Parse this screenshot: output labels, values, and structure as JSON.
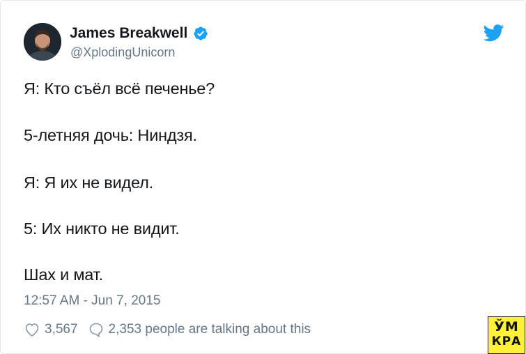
{
  "author": {
    "name": "James Breakwell",
    "handle": "@XplodingUnicorn",
    "verified_icon": "verified-badge-icon",
    "brand_color": "#1da1f2"
  },
  "tweet": {
    "lines": [
      "Я: Кто съёл всё печенье?",
      "5-летняя дочь: Ниндзя.",
      "Я:  Я их не видел.",
      "5: Их никто не видит.",
      "Шах и мат."
    ],
    "timestamp": "12:57 AM - Jun 7, 2015"
  },
  "engagement": {
    "likes": "3,567",
    "talking": "2,353 people are talking about this",
    "like_icon": "heart-icon",
    "reply_icon": "speech-bubble-icon"
  },
  "watermark": {
    "line1": "ЎМ",
    "line2": "КРА",
    "background": "#fff13a"
  }
}
